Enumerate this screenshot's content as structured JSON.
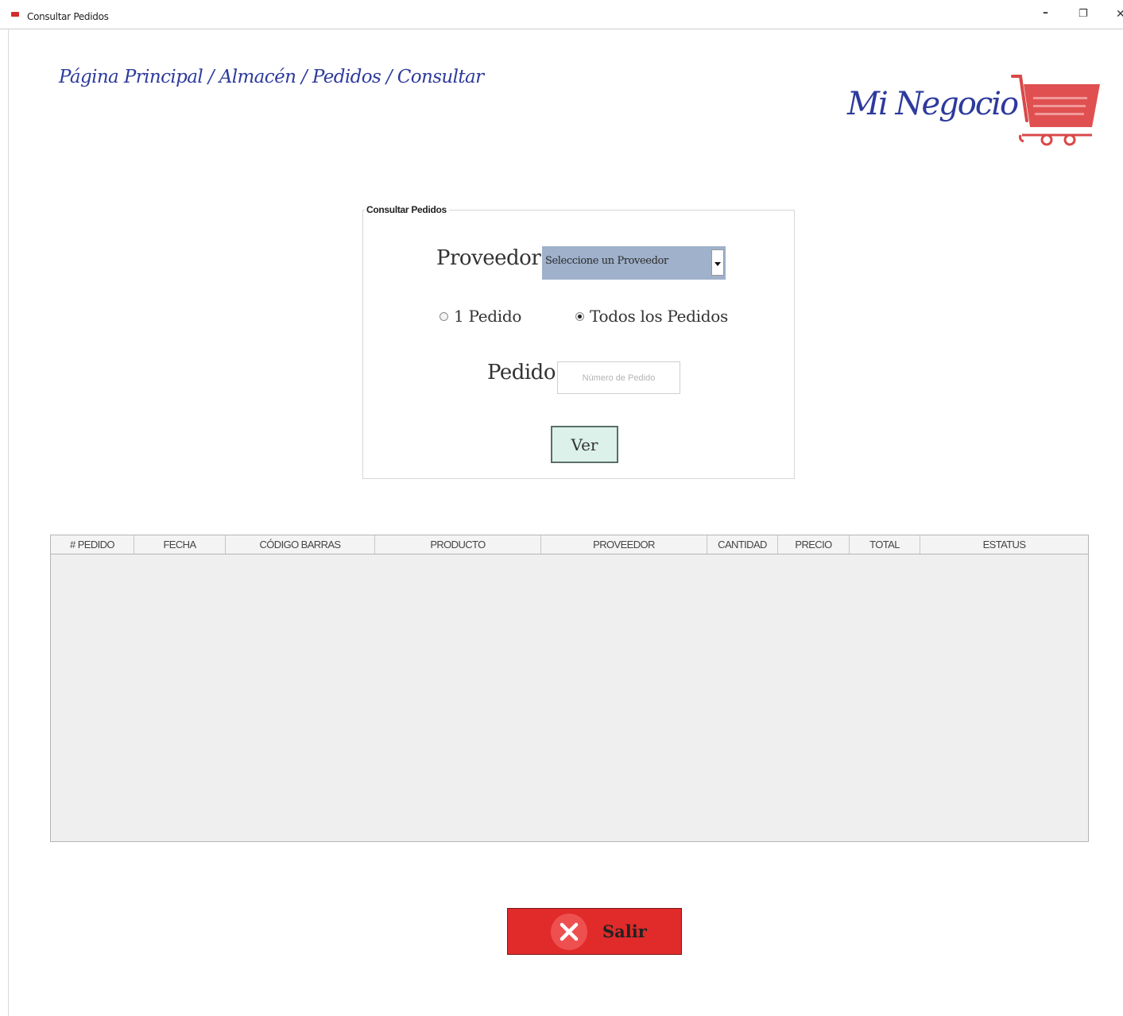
{
  "window": {
    "title": "Consultar Pedidos",
    "controls": {
      "minimize": "–",
      "maximize": "❐",
      "close": "✕"
    }
  },
  "breadcrumb": "Página Principal / Almacén / Pedidos / Consultar",
  "logo": {
    "text": "Mi Negocio",
    "icon": "shopping-cart-icon",
    "color": "#d94848"
  },
  "form": {
    "group_title": "Consultar Pedidos",
    "proveedor_label": "Proveedor:",
    "proveedor_selected": "Seleccione un Proveedor",
    "radio_one": "1 Pedido",
    "radio_all": "Todos los Pedidos",
    "radio_selected": "all",
    "pedido_label": "Pedido:",
    "pedido_placeholder": "Número de Pedido",
    "pedido_value": "",
    "ver_button": "Ver"
  },
  "table": {
    "columns": [
      "# PEDIDO",
      "FECHA",
      "CÓDIGO BARRAS",
      "PRODUCTO",
      "PROVEEDOR",
      "CANTIDAD",
      "PRECIO",
      "TOTAL",
      "ESTATUS"
    ],
    "rows": []
  },
  "salir_button": {
    "label": "Salir",
    "icon": "close-x-icon"
  },
  "colors": {
    "accent_blue": "#2d3a9c",
    "select_bg": "#9fb1cb",
    "ver_bg": "#dbf1ea",
    "salir_bg": "#e12a2a"
  }
}
